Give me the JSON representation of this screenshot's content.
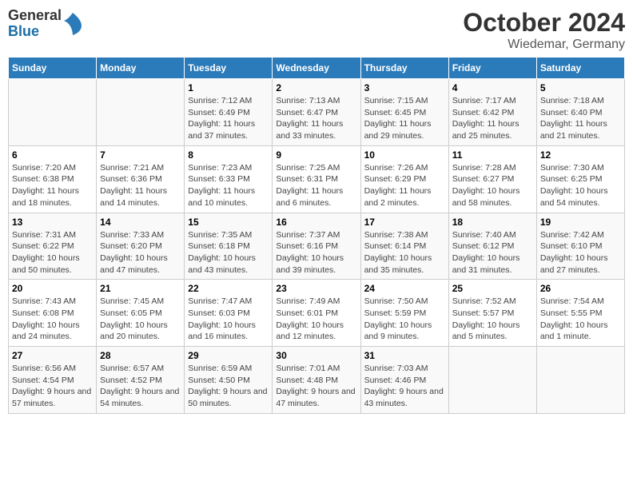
{
  "header": {
    "logo": {
      "general": "General",
      "blue": "Blue"
    },
    "title": "October 2024",
    "subtitle": "Wiedemar, Germany"
  },
  "calendar": {
    "weekdays": [
      "Sunday",
      "Monday",
      "Tuesday",
      "Wednesday",
      "Thursday",
      "Friday",
      "Saturday"
    ],
    "weeks": [
      [
        {
          "day": "",
          "content": ""
        },
        {
          "day": "",
          "content": ""
        },
        {
          "day": "1",
          "content": "Sunrise: 7:12 AM\nSunset: 6:49 PM\nDaylight: 11 hours and 37 minutes."
        },
        {
          "day": "2",
          "content": "Sunrise: 7:13 AM\nSunset: 6:47 PM\nDaylight: 11 hours and 33 minutes."
        },
        {
          "day": "3",
          "content": "Sunrise: 7:15 AM\nSunset: 6:45 PM\nDaylight: 11 hours and 29 minutes."
        },
        {
          "day": "4",
          "content": "Sunrise: 7:17 AM\nSunset: 6:42 PM\nDaylight: 11 hours and 25 minutes."
        },
        {
          "day": "5",
          "content": "Sunrise: 7:18 AM\nSunset: 6:40 PM\nDaylight: 11 hours and 21 minutes."
        }
      ],
      [
        {
          "day": "6",
          "content": "Sunrise: 7:20 AM\nSunset: 6:38 PM\nDaylight: 11 hours and 18 minutes."
        },
        {
          "day": "7",
          "content": "Sunrise: 7:21 AM\nSunset: 6:36 PM\nDaylight: 11 hours and 14 minutes."
        },
        {
          "day": "8",
          "content": "Sunrise: 7:23 AM\nSunset: 6:33 PM\nDaylight: 11 hours and 10 minutes."
        },
        {
          "day": "9",
          "content": "Sunrise: 7:25 AM\nSunset: 6:31 PM\nDaylight: 11 hours and 6 minutes."
        },
        {
          "day": "10",
          "content": "Sunrise: 7:26 AM\nSunset: 6:29 PM\nDaylight: 11 hours and 2 minutes."
        },
        {
          "day": "11",
          "content": "Sunrise: 7:28 AM\nSunset: 6:27 PM\nDaylight: 10 hours and 58 minutes."
        },
        {
          "day": "12",
          "content": "Sunrise: 7:30 AM\nSunset: 6:25 PM\nDaylight: 10 hours and 54 minutes."
        }
      ],
      [
        {
          "day": "13",
          "content": "Sunrise: 7:31 AM\nSunset: 6:22 PM\nDaylight: 10 hours and 50 minutes."
        },
        {
          "day": "14",
          "content": "Sunrise: 7:33 AM\nSunset: 6:20 PM\nDaylight: 10 hours and 47 minutes."
        },
        {
          "day": "15",
          "content": "Sunrise: 7:35 AM\nSunset: 6:18 PM\nDaylight: 10 hours and 43 minutes."
        },
        {
          "day": "16",
          "content": "Sunrise: 7:37 AM\nSunset: 6:16 PM\nDaylight: 10 hours and 39 minutes."
        },
        {
          "day": "17",
          "content": "Sunrise: 7:38 AM\nSunset: 6:14 PM\nDaylight: 10 hours and 35 minutes."
        },
        {
          "day": "18",
          "content": "Sunrise: 7:40 AM\nSunset: 6:12 PM\nDaylight: 10 hours and 31 minutes."
        },
        {
          "day": "19",
          "content": "Sunrise: 7:42 AM\nSunset: 6:10 PM\nDaylight: 10 hours and 27 minutes."
        }
      ],
      [
        {
          "day": "20",
          "content": "Sunrise: 7:43 AM\nSunset: 6:08 PM\nDaylight: 10 hours and 24 minutes."
        },
        {
          "day": "21",
          "content": "Sunrise: 7:45 AM\nSunset: 6:05 PM\nDaylight: 10 hours and 20 minutes."
        },
        {
          "day": "22",
          "content": "Sunrise: 7:47 AM\nSunset: 6:03 PM\nDaylight: 10 hours and 16 minutes."
        },
        {
          "day": "23",
          "content": "Sunrise: 7:49 AM\nSunset: 6:01 PM\nDaylight: 10 hours and 12 minutes."
        },
        {
          "day": "24",
          "content": "Sunrise: 7:50 AM\nSunset: 5:59 PM\nDaylight: 10 hours and 9 minutes."
        },
        {
          "day": "25",
          "content": "Sunrise: 7:52 AM\nSunset: 5:57 PM\nDaylight: 10 hours and 5 minutes."
        },
        {
          "day": "26",
          "content": "Sunrise: 7:54 AM\nSunset: 5:55 PM\nDaylight: 10 hours and 1 minute."
        }
      ],
      [
        {
          "day": "27",
          "content": "Sunrise: 6:56 AM\nSunset: 4:54 PM\nDaylight: 9 hours and 57 minutes."
        },
        {
          "day": "28",
          "content": "Sunrise: 6:57 AM\nSunset: 4:52 PM\nDaylight: 9 hours and 54 minutes."
        },
        {
          "day": "29",
          "content": "Sunrise: 6:59 AM\nSunset: 4:50 PM\nDaylight: 9 hours and 50 minutes."
        },
        {
          "day": "30",
          "content": "Sunrise: 7:01 AM\nSunset: 4:48 PM\nDaylight: 9 hours and 47 minutes."
        },
        {
          "day": "31",
          "content": "Sunrise: 7:03 AM\nSunset: 4:46 PM\nDaylight: 9 hours and 43 minutes."
        },
        {
          "day": "",
          "content": ""
        },
        {
          "day": "",
          "content": ""
        }
      ]
    ]
  }
}
